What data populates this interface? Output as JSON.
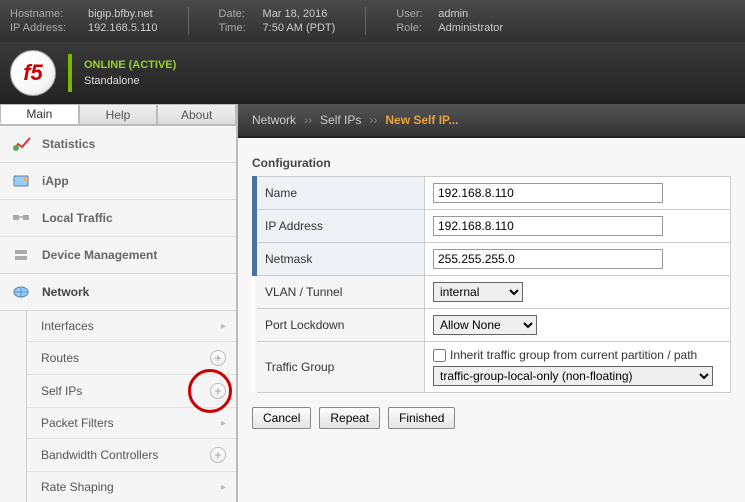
{
  "topbar": {
    "hostname_label": "Hostname:",
    "hostname": "bigip.bfby.net",
    "ip_label": "IP Address:",
    "ip": "192.168.5.110",
    "date_label": "Date:",
    "date": "Mar 18, 2016",
    "time_label": "Time:",
    "time": "7:50 AM (PDT)",
    "user_label": "User:",
    "user": "admin",
    "role_label": "Role:",
    "role": "Administrator"
  },
  "status": {
    "line1": "ONLINE (ACTIVE)",
    "line2": "Standalone"
  },
  "tabs": {
    "main": "Main",
    "help": "Help",
    "about": "About"
  },
  "nav": {
    "statistics": "Statistics",
    "iapp": "iApp",
    "localtraffic": "Local Traffic",
    "devicemgmt": "Device Management",
    "network": "Network",
    "sub": {
      "interfaces": "Interfaces",
      "routes": "Routes",
      "selfips": "Self IPs",
      "packetfilters": "Packet Filters",
      "bandwidth": "Bandwidth Controllers",
      "rateshaping": "Rate Shaping"
    }
  },
  "breadcrumb": {
    "a": "Network",
    "b": "Self IPs",
    "c": "New Self IP..."
  },
  "cfg": {
    "title": "Configuration",
    "name_label": "Name",
    "name_value": "192.168.8.110",
    "ip_label": "IP Address",
    "ip_value": "192.168.8.110",
    "netmask_label": "Netmask",
    "netmask_value": "255.255.255.0",
    "vlan_label": "VLAN / Tunnel",
    "vlan_value": "internal",
    "port_label": "Port Lockdown",
    "port_value": "Allow None",
    "tg_label": "Traffic Group",
    "tg_inherit": "Inherit traffic group from current partition / path",
    "tg_value": "traffic-group-local-only (non-floating)"
  },
  "buttons": {
    "cancel": "Cancel",
    "repeat": "Repeat",
    "finished": "Finished"
  }
}
